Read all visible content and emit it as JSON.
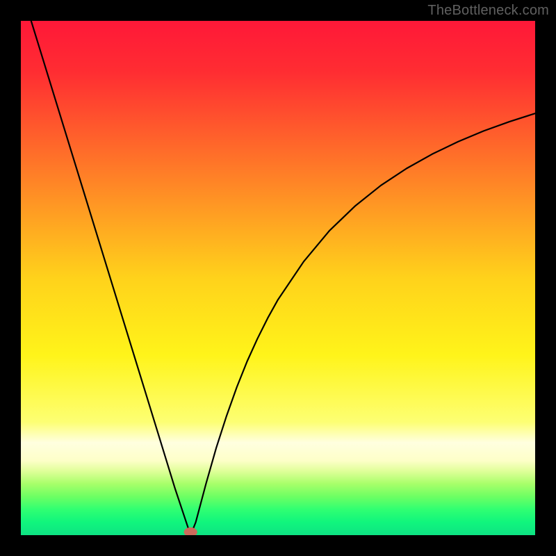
{
  "watermark": "TheBottleneck.com",
  "chart_data": {
    "type": "line",
    "title": "",
    "xlabel": "",
    "ylabel": "",
    "xlim": [
      0,
      100
    ],
    "ylim": [
      0,
      100
    ],
    "grid": false,
    "legend": false,
    "gradient_stops": [
      {
        "offset": 0.0,
        "color": "#ff1838"
      },
      {
        "offset": 0.1,
        "color": "#ff2d32"
      },
      {
        "offset": 0.3,
        "color": "#ff7f27"
      },
      {
        "offset": 0.5,
        "color": "#ffd21b"
      },
      {
        "offset": 0.65,
        "color": "#fff41a"
      },
      {
        "offset": 0.78,
        "color": "#fdff73"
      },
      {
        "offset": 0.82,
        "color": "#ffffe0"
      },
      {
        "offset": 0.855,
        "color": "#fdffc8"
      },
      {
        "offset": 0.875,
        "color": "#e0ff9a"
      },
      {
        "offset": 0.9,
        "color": "#a8ff6a"
      },
      {
        "offset": 0.925,
        "color": "#6dff63"
      },
      {
        "offset": 0.95,
        "color": "#30ff72"
      },
      {
        "offset": 0.975,
        "color": "#10f57d"
      },
      {
        "offset": 1.0,
        "color": "#0ee383"
      }
    ],
    "series": [
      {
        "name": "bottleneck-curve",
        "x": [
          2,
          4,
          6,
          8,
          10,
          12,
          14,
          16,
          18,
          20,
          22,
          24,
          26,
          28,
          30,
          32,
          33,
          34,
          36,
          38,
          40,
          42,
          44,
          46,
          48,
          50,
          55,
          60,
          65,
          70,
          75,
          80,
          85,
          90,
          95,
          100
        ],
        "values": [
          100,
          93.5,
          87,
          80.5,
          74,
          67.5,
          61,
          54.5,
          48,
          41.5,
          35,
          28.5,
          22,
          15.5,
          9,
          3,
          0,
          2.5,
          10,
          17,
          23.2,
          28.8,
          33.8,
          38.2,
          42.2,
          45.8,
          53.2,
          59.2,
          64,
          68,
          71.3,
          74.1,
          76.5,
          78.6,
          80.4,
          82
        ]
      }
    ],
    "marker": {
      "x": 33,
      "y": 0.6,
      "color": "#cc6a5c",
      "rx": 1.3,
      "ry": 0.9
    }
  }
}
